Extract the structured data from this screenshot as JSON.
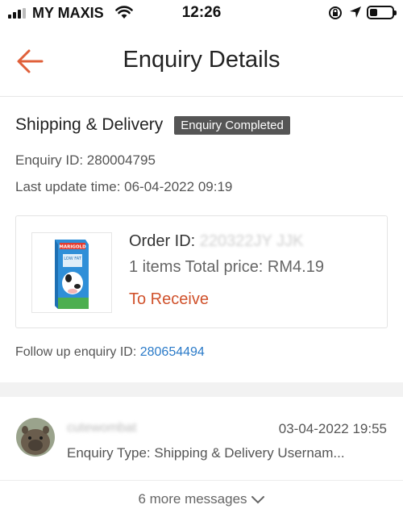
{
  "status_bar": {
    "carrier": "MY MAXIS",
    "time": "12:26",
    "battery_level": 0.35
  },
  "header": {
    "title": "Enquiry Details"
  },
  "enquiry": {
    "section_title": "Shipping & Delivery",
    "status_badge": "Enquiry Completed",
    "enquiry_id_line": "Enquiry ID: 280004795",
    "last_update_line": "Last update time: 06-04-2022 09:19"
  },
  "order": {
    "order_id_label": "Order ID: ",
    "order_id_value": "220322JY JJK",
    "items_line": "1 items  Total price: RM4.19",
    "status": "To Receive",
    "product_brand": "MARIGOLD",
    "product_variant": "LOW FAT"
  },
  "followup": {
    "label": "Follow up enquiry ID: ",
    "id": "280654494"
  },
  "message": {
    "sender": "cutewombat",
    "time": "03-04-2022 19:55",
    "preview": "Enquiry Type: Shipping & Delivery Usernam..."
  },
  "more_messages": {
    "label": "6 more messages"
  },
  "colors": {
    "accent": "#d0522c",
    "link": "#2a7ac8",
    "badge_bg": "#555555"
  }
}
